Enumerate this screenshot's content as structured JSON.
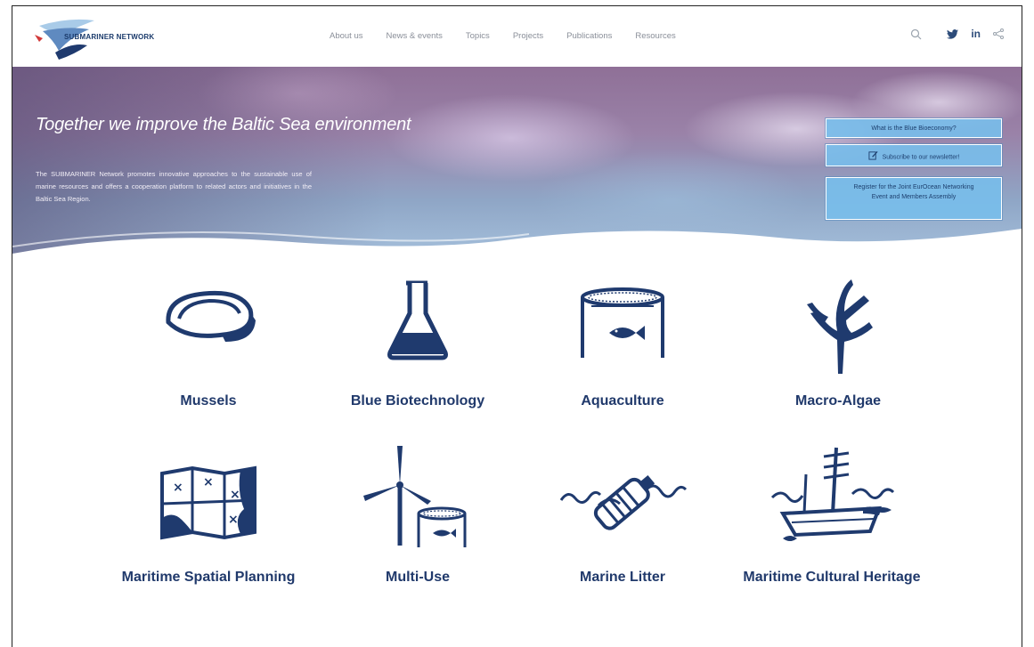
{
  "brand": {
    "logo_text": "SUBMARINER NETWORK"
  },
  "nav": {
    "items": [
      "About us",
      "News & events",
      "Topics",
      "Projects",
      "Publications",
      "Resources"
    ]
  },
  "header_icons": [
    "search-icon",
    "twitter-icon",
    "linkedin-icon",
    "share-icon"
  ],
  "header_linkedin_text": "in",
  "hero": {
    "title": "Together we improve the Baltic Sea environment",
    "text": "The SUBMARINER Network promotes innovative approaches to the sustainable use of marine resources and offers a cooperation platform to related actors and initiatives in the Baltic Sea Region.",
    "cta": [
      "What is the Blue Bioeconomy?",
      "Subscribe to our newsletter!",
      "Register for the Joint EurOcean Networking Event and Members Assembly"
    ]
  },
  "topics": [
    {
      "label": "Mussels",
      "icon": "mussel-icon"
    },
    {
      "label": "Blue Biotechnology",
      "icon": "flask-icon"
    },
    {
      "label": "Aquaculture",
      "icon": "fish-cage-icon"
    },
    {
      "label": "Macro-Algae",
      "icon": "algae-icon"
    },
    {
      "label": "Maritime Spatial Planning",
      "icon": "map-icon"
    },
    {
      "label": "Multi-Use",
      "icon": "wind-turbine-icon"
    },
    {
      "label": "Marine Litter",
      "icon": "bottle-waves-icon"
    },
    {
      "label": "Maritime Cultural Heritage",
      "icon": "shipwreck-icon"
    }
  ],
  "colors": {
    "brand_navy": "#1f3a6e",
    "cta_blue": "#78bee8",
    "nav_grey": "#8a8f99"
  }
}
